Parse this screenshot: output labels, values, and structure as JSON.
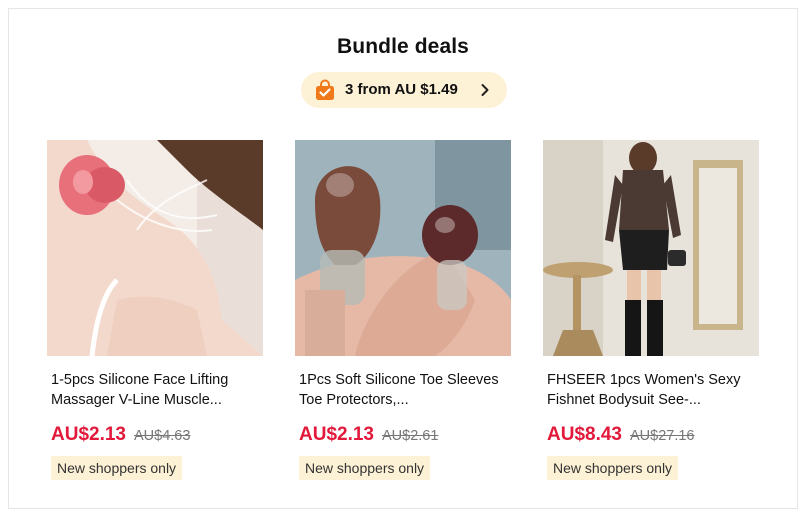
{
  "section": {
    "title": "Bundle deals",
    "promo_label": "3 from AU $1.49",
    "promo_icon": "shopping-bag-check-icon",
    "accent_color": "#e2193b",
    "badge_color": "#fdf1d6"
  },
  "products": [
    {
      "name": "1-5pcs Silicone Face Lifting Massager V-Line Muscle...",
      "price": "AU$2.13",
      "original_price": "AU$4.63",
      "badge": "New shoppers only"
    },
    {
      "name": "1Pcs Soft Silicone Toe Sleeves Toe Protectors,...",
      "price": "AU$2.13",
      "original_price": "AU$2.61",
      "badge": "New shoppers only"
    },
    {
      "name": "FHSEER 1pcs Women's Sexy Fishnet Bodysuit See-...",
      "price": "AU$8.43",
      "original_price": "AU$27.16",
      "badge": "New shoppers only"
    }
  ]
}
